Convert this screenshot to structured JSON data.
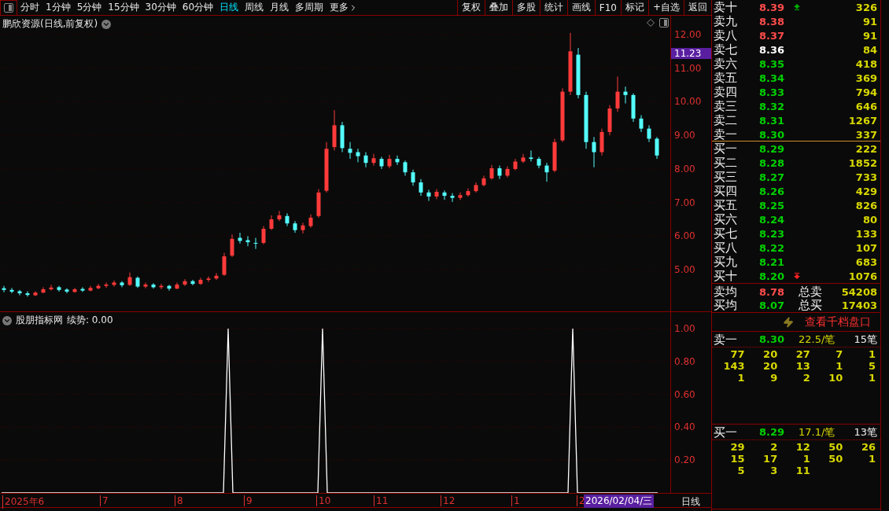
{
  "toolbar": {
    "tabs": [
      {
        "label": "分时",
        "selected": false
      },
      {
        "label": "1分钟",
        "selected": false
      },
      {
        "label": "5分钟",
        "selected": false
      },
      {
        "label": "15分钟",
        "selected": false
      },
      {
        "label": "30分钟",
        "selected": false
      },
      {
        "label": "60分钟",
        "selected": false
      },
      {
        "label": "日线",
        "selected": true
      },
      {
        "label": "周线",
        "selected": false
      },
      {
        "label": "月线",
        "selected": false
      },
      {
        "label": "多周期",
        "selected": false
      },
      {
        "label": "更多",
        "selected": false
      }
    ],
    "buttons": [
      "复权",
      "叠加",
      "多股",
      "统计",
      "画线",
      "F10",
      "标记",
      "+自选",
      "返回"
    ]
  },
  "main_chart": {
    "title": "鹏欣资源(日线,前复权)",
    "current_price": "11.23",
    "chart_data": {
      "type": "candlestick",
      "ylim": [
        3.74,
        12.56
      ],
      "grid": true,
      "yticks": [
        {
          "value": 12,
          "label": "12.00"
        },
        {
          "value": 11,
          "label": "11.00"
        },
        {
          "value": 10,
          "label": "10.00"
        },
        {
          "value": 9,
          "label": "9.00"
        },
        {
          "value": 8,
          "label": "8.00"
        },
        {
          "value": 7,
          "label": "7.00"
        },
        {
          "value": 6,
          "label": "6.00"
        },
        {
          "value": 5,
          "label": "5.00"
        }
      ],
      "categories": [
        null,
        null,
        null,
        null,
        null,
        null,
        null,
        null,
        null,
        null,
        null,
        null,
        null,
        null,
        null,
        null,
        null,
        null,
        null,
        null,
        null,
        null,
        null,
        null,
        null,
        null,
        null,
        null,
        null,
        null,
        null,
        null,
        null,
        null,
        null,
        null,
        null,
        null,
        null,
        null,
        null,
        null,
        null,
        null,
        null,
        null,
        null,
        null,
        null,
        null,
        null,
        null,
        null,
        null,
        null,
        null,
        null,
        null,
        null,
        null,
        null,
        null,
        null,
        null,
        null,
        null,
        null,
        null,
        null,
        null,
        null,
        null,
        null,
        null,
        null,
        null,
        null,
        null,
        null,
        null,
        null,
        null,
        null,
        null
      ],
      "ohlc": [
        [
          4.45,
          4.52,
          4.33,
          4.4
        ],
        [
          4.4,
          4.46,
          4.3,
          4.35
        ],
        [
          4.36,
          4.4,
          4.24,
          4.3
        ],
        [
          4.3,
          4.36,
          4.2,
          4.25
        ],
        [
          4.24,
          4.36,
          4.22,
          4.32
        ],
        [
          4.32,
          4.48,
          4.3,
          4.42
        ],
        [
          4.42,
          4.55,
          4.38,
          4.47
        ],
        [
          4.48,
          4.52,
          4.35,
          4.4
        ],
        [
          4.41,
          4.45,
          4.3,
          4.35
        ],
        [
          4.34,
          4.46,
          4.32,
          4.42
        ],
        [
          4.43,
          4.48,
          4.34,
          4.38
        ],
        [
          4.38,
          4.52,
          4.36,
          4.46
        ],
        [
          4.45,
          4.58,
          4.42,
          4.52
        ],
        [
          4.52,
          4.62,
          4.46,
          4.56
        ],
        [
          4.55,
          4.68,
          4.5,
          4.62
        ],
        [
          4.62,
          4.66,
          4.48,
          4.54
        ],
        [
          4.55,
          4.92,
          4.52,
          4.78
        ],
        [
          4.76,
          4.8,
          4.46,
          4.5
        ],
        [
          4.5,
          4.62,
          4.45,
          4.56
        ],
        [
          4.56,
          4.6,
          4.44,
          4.48
        ],
        [
          4.48,
          4.58,
          4.42,
          4.52
        ],
        [
          4.52,
          4.55,
          4.38,
          4.44
        ],
        [
          4.44,
          4.62,
          4.42,
          4.56
        ],
        [
          4.56,
          4.72,
          4.52,
          4.66
        ],
        [
          4.66,
          4.7,
          4.54,
          4.58
        ],
        [
          4.58,
          4.76,
          4.55,
          4.7
        ],
        [
          4.7,
          4.8,
          4.64,
          4.74
        ],
        [
          4.74,
          4.9,
          4.7,
          4.82
        ],
        [
          4.85,
          5.5,
          4.82,
          5.4
        ],
        [
          5.42,
          6.05,
          5.38,
          5.92
        ],
        [
          5.95,
          6.1,
          5.78,
          5.86
        ],
        [
          5.88,
          6.0,
          5.7,
          5.82
        ],
        [
          5.8,
          5.95,
          5.62,
          5.78
        ],
        [
          5.8,
          6.3,
          5.76,
          6.22
        ],
        [
          6.22,
          6.62,
          6.18,
          6.5
        ],
        [
          6.5,
          6.75,
          6.45,
          6.62
        ],
        [
          6.6,
          6.68,
          6.3,
          6.38
        ],
        [
          6.38,
          6.45,
          6.1,
          6.18
        ],
        [
          6.18,
          6.4,
          6.08,
          6.32
        ],
        [
          6.3,
          6.65,
          6.25,
          6.55
        ],
        [
          6.6,
          7.4,
          6.55,
          7.3
        ],
        [
          7.35,
          8.8,
          7.3,
          8.6
        ],
        [
          8.65,
          9.75,
          8.55,
          9.3
        ],
        [
          9.3,
          9.4,
          8.5,
          8.62
        ],
        [
          8.6,
          8.8,
          8.3,
          8.48
        ],
        [
          8.5,
          8.6,
          8.2,
          8.38
        ],
        [
          8.4,
          8.5,
          8.05,
          8.18
        ],
        [
          8.18,
          8.45,
          8.1,
          8.32
        ],
        [
          8.3,
          8.36,
          8.0,
          8.08
        ],
        [
          8.08,
          8.42,
          8.02,
          8.3
        ],
        [
          8.3,
          8.4,
          8.12,
          8.2
        ],
        [
          8.2,
          8.25,
          7.8,
          7.9
        ],
        [
          7.9,
          7.98,
          7.5,
          7.6
        ],
        [
          7.6,
          7.7,
          7.2,
          7.3
        ],
        [
          7.3,
          7.38,
          7.05,
          7.18
        ],
        [
          7.18,
          7.4,
          7.1,
          7.32
        ],
        [
          7.3,
          7.36,
          7.08,
          7.2
        ],
        [
          7.2,
          7.28,
          7.02,
          7.14
        ],
        [
          7.14,
          7.3,
          7.08,
          7.22
        ],
        [
          7.22,
          7.42,
          7.18,
          7.34
        ],
        [
          7.34,
          7.6,
          7.3,
          7.52
        ],
        [
          7.52,
          7.8,
          7.48,
          7.72
        ],
        [
          7.72,
          8.12,
          7.68,
          8.02
        ],
        [
          8.02,
          8.1,
          7.7,
          7.8
        ],
        [
          7.8,
          8.08,
          7.75,
          8.0
        ],
        [
          8.0,
          8.3,
          7.96,
          8.22
        ],
        [
          8.22,
          8.45,
          8.18,
          8.34
        ],
        [
          8.34,
          8.55,
          8.22,
          8.3
        ],
        [
          8.3,
          8.36,
          8.02,
          8.1
        ],
        [
          8.1,
          8.18,
          7.62,
          7.9
        ],
        [
          7.95,
          8.9,
          7.9,
          8.8
        ],
        [
          8.85,
          10.4,
          8.8,
          10.3
        ],
        [
          10.3,
          12.05,
          10.2,
          11.5
        ],
        [
          11.4,
          11.6,
          10.1,
          10.2
        ],
        [
          10.2,
          10.3,
          8.6,
          8.8
        ],
        [
          8.8,
          8.95,
          8.05,
          8.5
        ],
        [
          8.5,
          9.2,
          8.4,
          9.1
        ],
        [
          9.1,
          9.9,
          9.0,
          9.8
        ],
        [
          9.8,
          10.75,
          9.7,
          10.3
        ],
        [
          10.3,
          10.45,
          9.95,
          10.2
        ],
        [
          10.2,
          10.25,
          9.4,
          9.5
        ],
        [
          9.5,
          9.6,
          9.1,
          9.2
        ],
        [
          9.2,
          9.3,
          8.8,
          8.9
        ],
        [
          8.9,
          8.95,
          8.3,
          8.4
        ]
      ]
    }
  },
  "indicator": {
    "title": "股朋指标网",
    "reading": "续势: 0.00",
    "chart_data": {
      "type": "line",
      "ylim": [
        0,
        1.1
      ],
      "grid": true,
      "yticks": [
        {
          "value": 0.2,
          "label": "0.20"
        },
        {
          "value": 0.4,
          "label": "0.40"
        },
        {
          "value": 0.6,
          "label": "0.60"
        },
        {
          "value": 0.8,
          "label": "0.80"
        },
        {
          "value": 1.0,
          "label": "1.00"
        }
      ],
      "series": [
        {
          "color": "#ffffff",
          "values": [
            0,
            0,
            0,
            0,
            0,
            0,
            0,
            0,
            0,
            0,
            0,
            0,
            0,
            0,
            0,
            0,
            0,
            0,
            0,
            0,
            0,
            0,
            0,
            0,
            0,
            0,
            0,
            0,
            0,
            0,
            0,
            0,
            0,
            0,
            0,
            0,
            0,
            0,
            0,
            0,
            0,
            0,
            0,
            0,
            0,
            0,
            0,
            0,
            1,
            0,
            0,
            0,
            0,
            0,
            0,
            0,
            0,
            0,
            0,
            0,
            0,
            0,
            0,
            0,
            0,
            0,
            0,
            0,
            1,
            0,
            0,
            0,
            0,
            0,
            0,
            0,
            0,
            0,
            0,
            0,
            0,
            0,
            0,
            0,
            0,
            0,
            0,
            0,
            0,
            0,
            0,
            0,
            0,
            0,
            0,
            0,
            0,
            0,
            0,
            0,
            0,
            0,
            0,
            0,
            0,
            0,
            0,
            0,
            0,
            0,
            0,
            0,
            0,
            0,
            0,
            0,
            0,
            0,
            0,
            0,
            0,
            1,
            0,
            0,
            0,
            0,
            0,
            0,
            0,
            0,
            0,
            0,
            0,
            0,
            0,
            0,
            0,
            0,
            0,
            0
          ]
        }
      ]
    }
  },
  "time_axis": {
    "labels": [
      "2025年6",
      "7",
      "8",
      "9",
      "10",
      "11",
      "12",
      "1",
      "2"
    ],
    "cursor_date": "2026/02/04/三",
    "period": "日线"
  },
  "order_book": {
    "asks": [
      {
        "label": "卖十",
        "price": "8.39",
        "color": "#ff4c4c",
        "volume": "326",
        "arrow": true
      },
      {
        "label": "卖九",
        "price": "8.38",
        "color": "#ff4c4c",
        "volume": "91",
        "arrow": false
      },
      {
        "label": "卖八",
        "price": "8.37",
        "color": "#ff4c4c",
        "volume": "91",
        "arrow": false
      },
      {
        "label": "卖七",
        "price": "8.36",
        "color": "#ffffff",
        "volume": "84",
        "arrow": false
      },
      {
        "label": "卖六",
        "price": "8.35",
        "color": "#00d000",
        "volume": "418",
        "arrow": false
      },
      {
        "label": "卖五",
        "price": "8.34",
        "color": "#00d000",
        "volume": "369",
        "arrow": false
      },
      {
        "label": "卖四",
        "price": "8.33",
        "color": "#00d000",
        "volume": "794",
        "arrow": false
      },
      {
        "label": "卖三",
        "price": "8.32",
        "color": "#00d000",
        "volume": "646",
        "arrow": false
      },
      {
        "label": "卖二",
        "price": "8.31",
        "color": "#00d000",
        "volume": "1267",
        "arrow": false
      },
      {
        "label": "卖一",
        "price": "8.30",
        "color": "#00d000",
        "volume": "337",
        "arrow": false
      }
    ],
    "bids": [
      {
        "label": "买一",
        "price": "8.29",
        "color": "#00d000",
        "volume": "222",
        "arrow": false
      },
      {
        "label": "买二",
        "price": "8.28",
        "color": "#00d000",
        "volume": "1852",
        "arrow": false
      },
      {
        "label": "买三",
        "price": "8.27",
        "color": "#00d000",
        "volume": "733",
        "arrow": false
      },
      {
        "label": "买四",
        "price": "8.26",
        "color": "#00d000",
        "volume": "429",
        "arrow": false
      },
      {
        "label": "买五",
        "price": "8.25",
        "color": "#00d000",
        "volume": "826",
        "arrow": false
      },
      {
        "label": "买六",
        "price": "8.24",
        "color": "#00d000",
        "volume": "80",
        "arrow": false
      },
      {
        "label": "买七",
        "price": "8.23",
        "color": "#00d000",
        "volume": "133",
        "arrow": false
      },
      {
        "label": "买八",
        "price": "8.22",
        "color": "#00d000",
        "volume": "107",
        "arrow": false
      },
      {
        "label": "买九",
        "price": "8.21",
        "color": "#00d000",
        "volume": "683",
        "arrow": false
      },
      {
        "label": "买十",
        "price": "8.20",
        "color": "#00d000",
        "volume": "1076",
        "arrow": true
      }
    ],
    "summary": [
      {
        "label": "卖均",
        "price": "8.78",
        "color": "#ff4c4c",
        "total_label": "总卖",
        "total": "54208"
      },
      {
        "label": "买均",
        "price": "8.07",
        "color": "#00d000",
        "total_label": "总买",
        "total": "17403"
      }
    ],
    "link": "查看千档盘口",
    "queues": [
      {
        "label": "卖一",
        "price": "8.30",
        "avg": "22.5/笔",
        "count": "15笔",
        "orders": [
          [
            "77",
            "20",
            "27",
            "7",
            "1"
          ],
          [
            "143",
            "20",
            "13",
            "1",
            "5"
          ],
          [
            "1",
            "9",
            "2",
            "10",
            "1"
          ]
        ]
      },
      {
        "label": "买一",
        "price": "8.29",
        "avg": "17.1/笔",
        "count": "13笔",
        "orders": [
          [
            "29",
            "2",
            "12",
            "50",
            "26"
          ],
          [
            "15",
            "17",
            "1",
            "50",
            "1"
          ],
          [
            "5",
            "3",
            "11"
          ]
        ]
      }
    ]
  }
}
